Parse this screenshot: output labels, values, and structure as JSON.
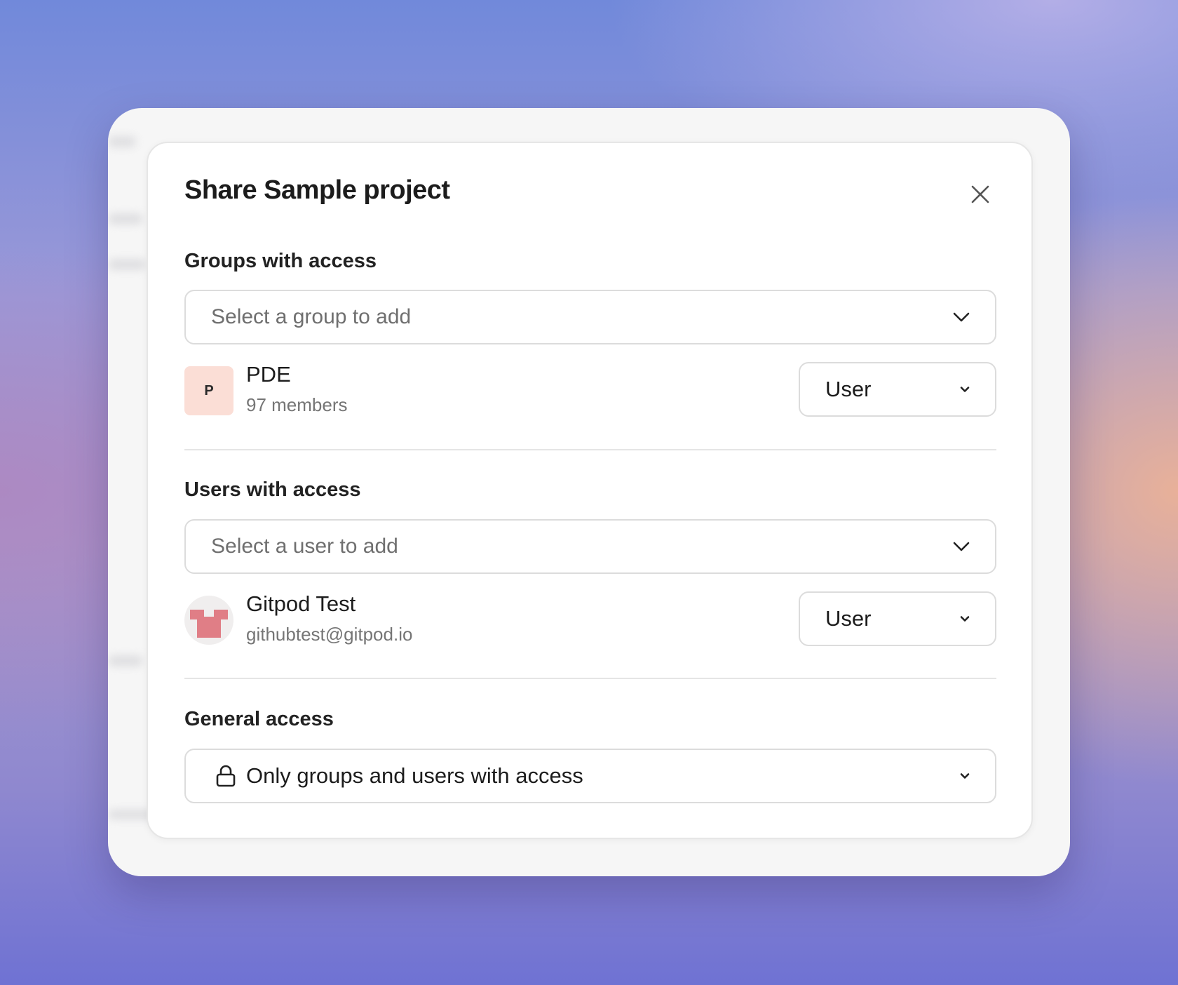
{
  "dialog": {
    "title": "Share Sample project",
    "close_icon": "close-icon"
  },
  "groups": {
    "label": "Groups with access",
    "select_placeholder": "Select a group to add",
    "items": [
      {
        "initial": "P",
        "name": "PDE",
        "subtitle": "97 members",
        "role": "User"
      }
    ]
  },
  "users": {
    "label": "Users with access",
    "select_placeholder": "Select a user to add",
    "items": [
      {
        "name": "Gitpod Test",
        "subtitle": "githubtest@gitpod.io",
        "role": "User"
      }
    ]
  },
  "general": {
    "label": "General access",
    "value": "Only groups and users with access",
    "icon": "lock-icon"
  },
  "colors": {
    "group_avatar_bg": "#fbded6",
    "user_avatar_accent": "#e07e86"
  }
}
